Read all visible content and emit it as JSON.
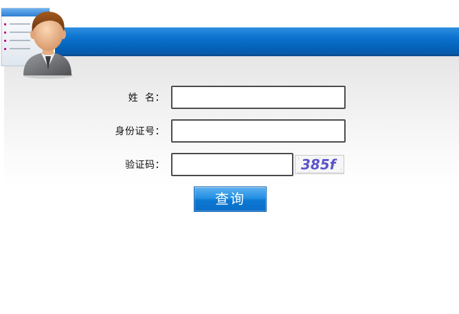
{
  "form": {
    "name_label": "姓  名：",
    "id_label": "身份证号：",
    "captcha_label": "验证码：",
    "name_value": "",
    "id_value": "",
    "captcha_value": ""
  },
  "captcha": {
    "text": "385f"
  },
  "buttons": {
    "query_label": "查询"
  },
  "colors": {
    "header_blue": "#0868c2",
    "button_blue": "#1687dc",
    "captcha_text": "#5b55c8"
  },
  "icons": {
    "avatar": "user-profile-icon"
  }
}
